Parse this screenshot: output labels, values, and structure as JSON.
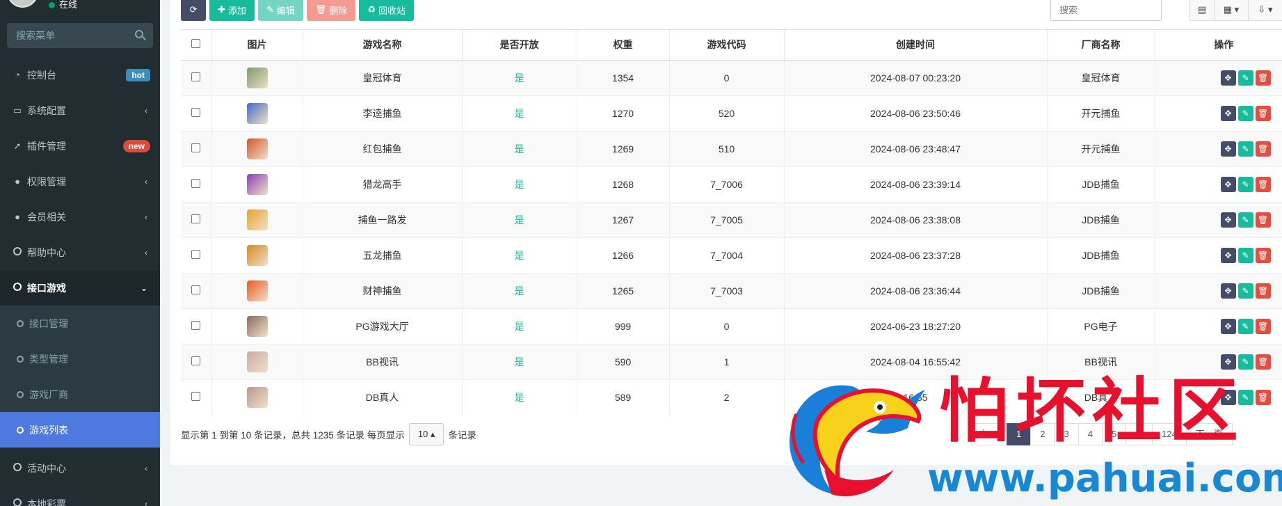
{
  "sidebar": {
    "status": "在线",
    "search_placeholder": "搜索菜单",
    "menu": {
      "dashboard": "控制台",
      "dashboard_badge": "hot",
      "system": "系统配置",
      "plugins": "插件管理",
      "plugins_badge": "new",
      "permissions": "权限管理",
      "members": "会员相关",
      "help": "帮助中心",
      "api_games": "接口游戏",
      "activity": "活动中心",
      "lottery": "本地彩票"
    },
    "submenu": {
      "api_manage": "接口管理",
      "type_manage": "类型管理",
      "vendors": "游戏厂商",
      "game_list": "游戏列表"
    }
  },
  "toolbar": {
    "add": "添加",
    "edit": "编辑",
    "delete": "删除",
    "recycle": "回收站",
    "search_placeholder": "搜索"
  },
  "table": {
    "headers": {
      "image": "图片",
      "name": "游戏名称",
      "open": "是否开放",
      "weight": "权重",
      "code": "游戏代码",
      "created": "创建时间",
      "vendor": "厂商名称",
      "ops": "操作"
    },
    "rows": [
      {
        "name": "皇冠体育",
        "open": "是",
        "weight": "1354",
        "code": "0",
        "created": "2024-08-07 00:23:20",
        "vendor": "皇冠体育",
        "thumb_color": "#7a9a6a"
      },
      {
        "name": "李逵捕鱼",
        "open": "是",
        "weight": "1270",
        "code": "520",
        "created": "2024-08-06 23:50:46",
        "vendor": "开元捕鱼",
        "thumb_color": "#3f6cc4"
      },
      {
        "name": "红包捕鱼",
        "open": "是",
        "weight": "1269",
        "code": "510",
        "created": "2024-08-06 23:48:47",
        "vendor": "开元捕鱼",
        "thumb_color": "#d2542c"
      },
      {
        "name": "猎龙高手",
        "open": "是",
        "weight": "1268",
        "code": "7_7006",
        "created": "2024-08-06 23:39:14",
        "vendor": "JDB捕鱼",
        "thumb_color": "#8a3fb4"
      },
      {
        "name": "捕鱼一路发",
        "open": "是",
        "weight": "1267",
        "code": "7_7005",
        "created": "2024-08-06 23:38:08",
        "vendor": "JDB捕鱼",
        "thumb_color": "#e6a32c"
      },
      {
        "name": "五龙捕鱼",
        "open": "是",
        "weight": "1266",
        "code": "7_7004",
        "created": "2024-08-06 23:37:28",
        "vendor": "JDB捕鱼",
        "thumb_color": "#d68a1e"
      },
      {
        "name": "财神捕鱼",
        "open": "是",
        "weight": "1265",
        "code": "7_7003",
        "created": "2024-08-06 23:36:44",
        "vendor": "JDB捕鱼",
        "thumb_color": "#e55b24"
      },
      {
        "name": "PG游戏大厅",
        "open": "是",
        "weight": "999",
        "code": "0",
        "created": "2024-06-23 18:27:20",
        "vendor": "PG电子",
        "thumb_color": "#8b6a5e"
      },
      {
        "name": "BB视讯",
        "open": "是",
        "weight": "590",
        "code": "1",
        "created": "2024-08-04 16:55:42",
        "vendor": "BB视讯",
        "thumb_color": "#c9a8a0"
      },
      {
        "name": "DB真人",
        "open": "是",
        "weight": "589",
        "code": "2",
        "created": "16:55",
        "vendor": "DB真人",
        "thumb_color": "#b8988e"
      }
    ]
  },
  "footer": {
    "info": "显示第 1 到第 10 条记录，总共 1235 条记录 每页显示",
    "page_size": "10",
    "info_suffix": "条记录",
    "pages": [
      "上一",
      "1",
      "2",
      "3",
      "4",
      "5",
      "...",
      "124",
      "下一页"
    ]
  },
  "watermark": {
    "title": "怕坏社区",
    "url": "www.pahuai.com"
  }
}
